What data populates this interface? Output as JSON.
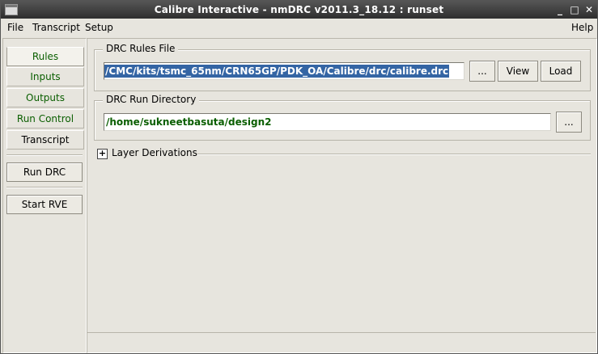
{
  "window": {
    "title": "Calibre Interactive - nmDRC v2011.3_18.12 : runset",
    "minimize_glyph": "_",
    "maximize_glyph": "□",
    "close_glyph": "✕"
  },
  "menu": {
    "file": "File",
    "transcript": "Transcript",
    "setup": "Setup",
    "help": "Help"
  },
  "nav": {
    "rules": "Rules",
    "inputs": "Inputs",
    "outputs": "Outputs",
    "run_control": "Run Control",
    "transcript": "Transcript",
    "run_drc": "Run DRC",
    "start_rve": "Start RVE"
  },
  "rules_file": {
    "label": "DRC Rules File",
    "path": "/CMC/kits/tsmc_65nm/CRN65GP/PDK_OA/Calibre/drc/calibre.drc",
    "browse": "...",
    "view": "View",
    "load": "Load"
  },
  "run_dir": {
    "label": "DRC Run Directory",
    "path": "/home/sukneetbasuta/design2",
    "browse": "..."
  },
  "layer_derivations": {
    "toggle": "+",
    "label": "Layer Derivations"
  },
  "colors": {
    "title_bar": "#3a3a3a",
    "nav_text": "#0a5e00",
    "selection": "#3465a4",
    "background": "#e7e5de"
  }
}
